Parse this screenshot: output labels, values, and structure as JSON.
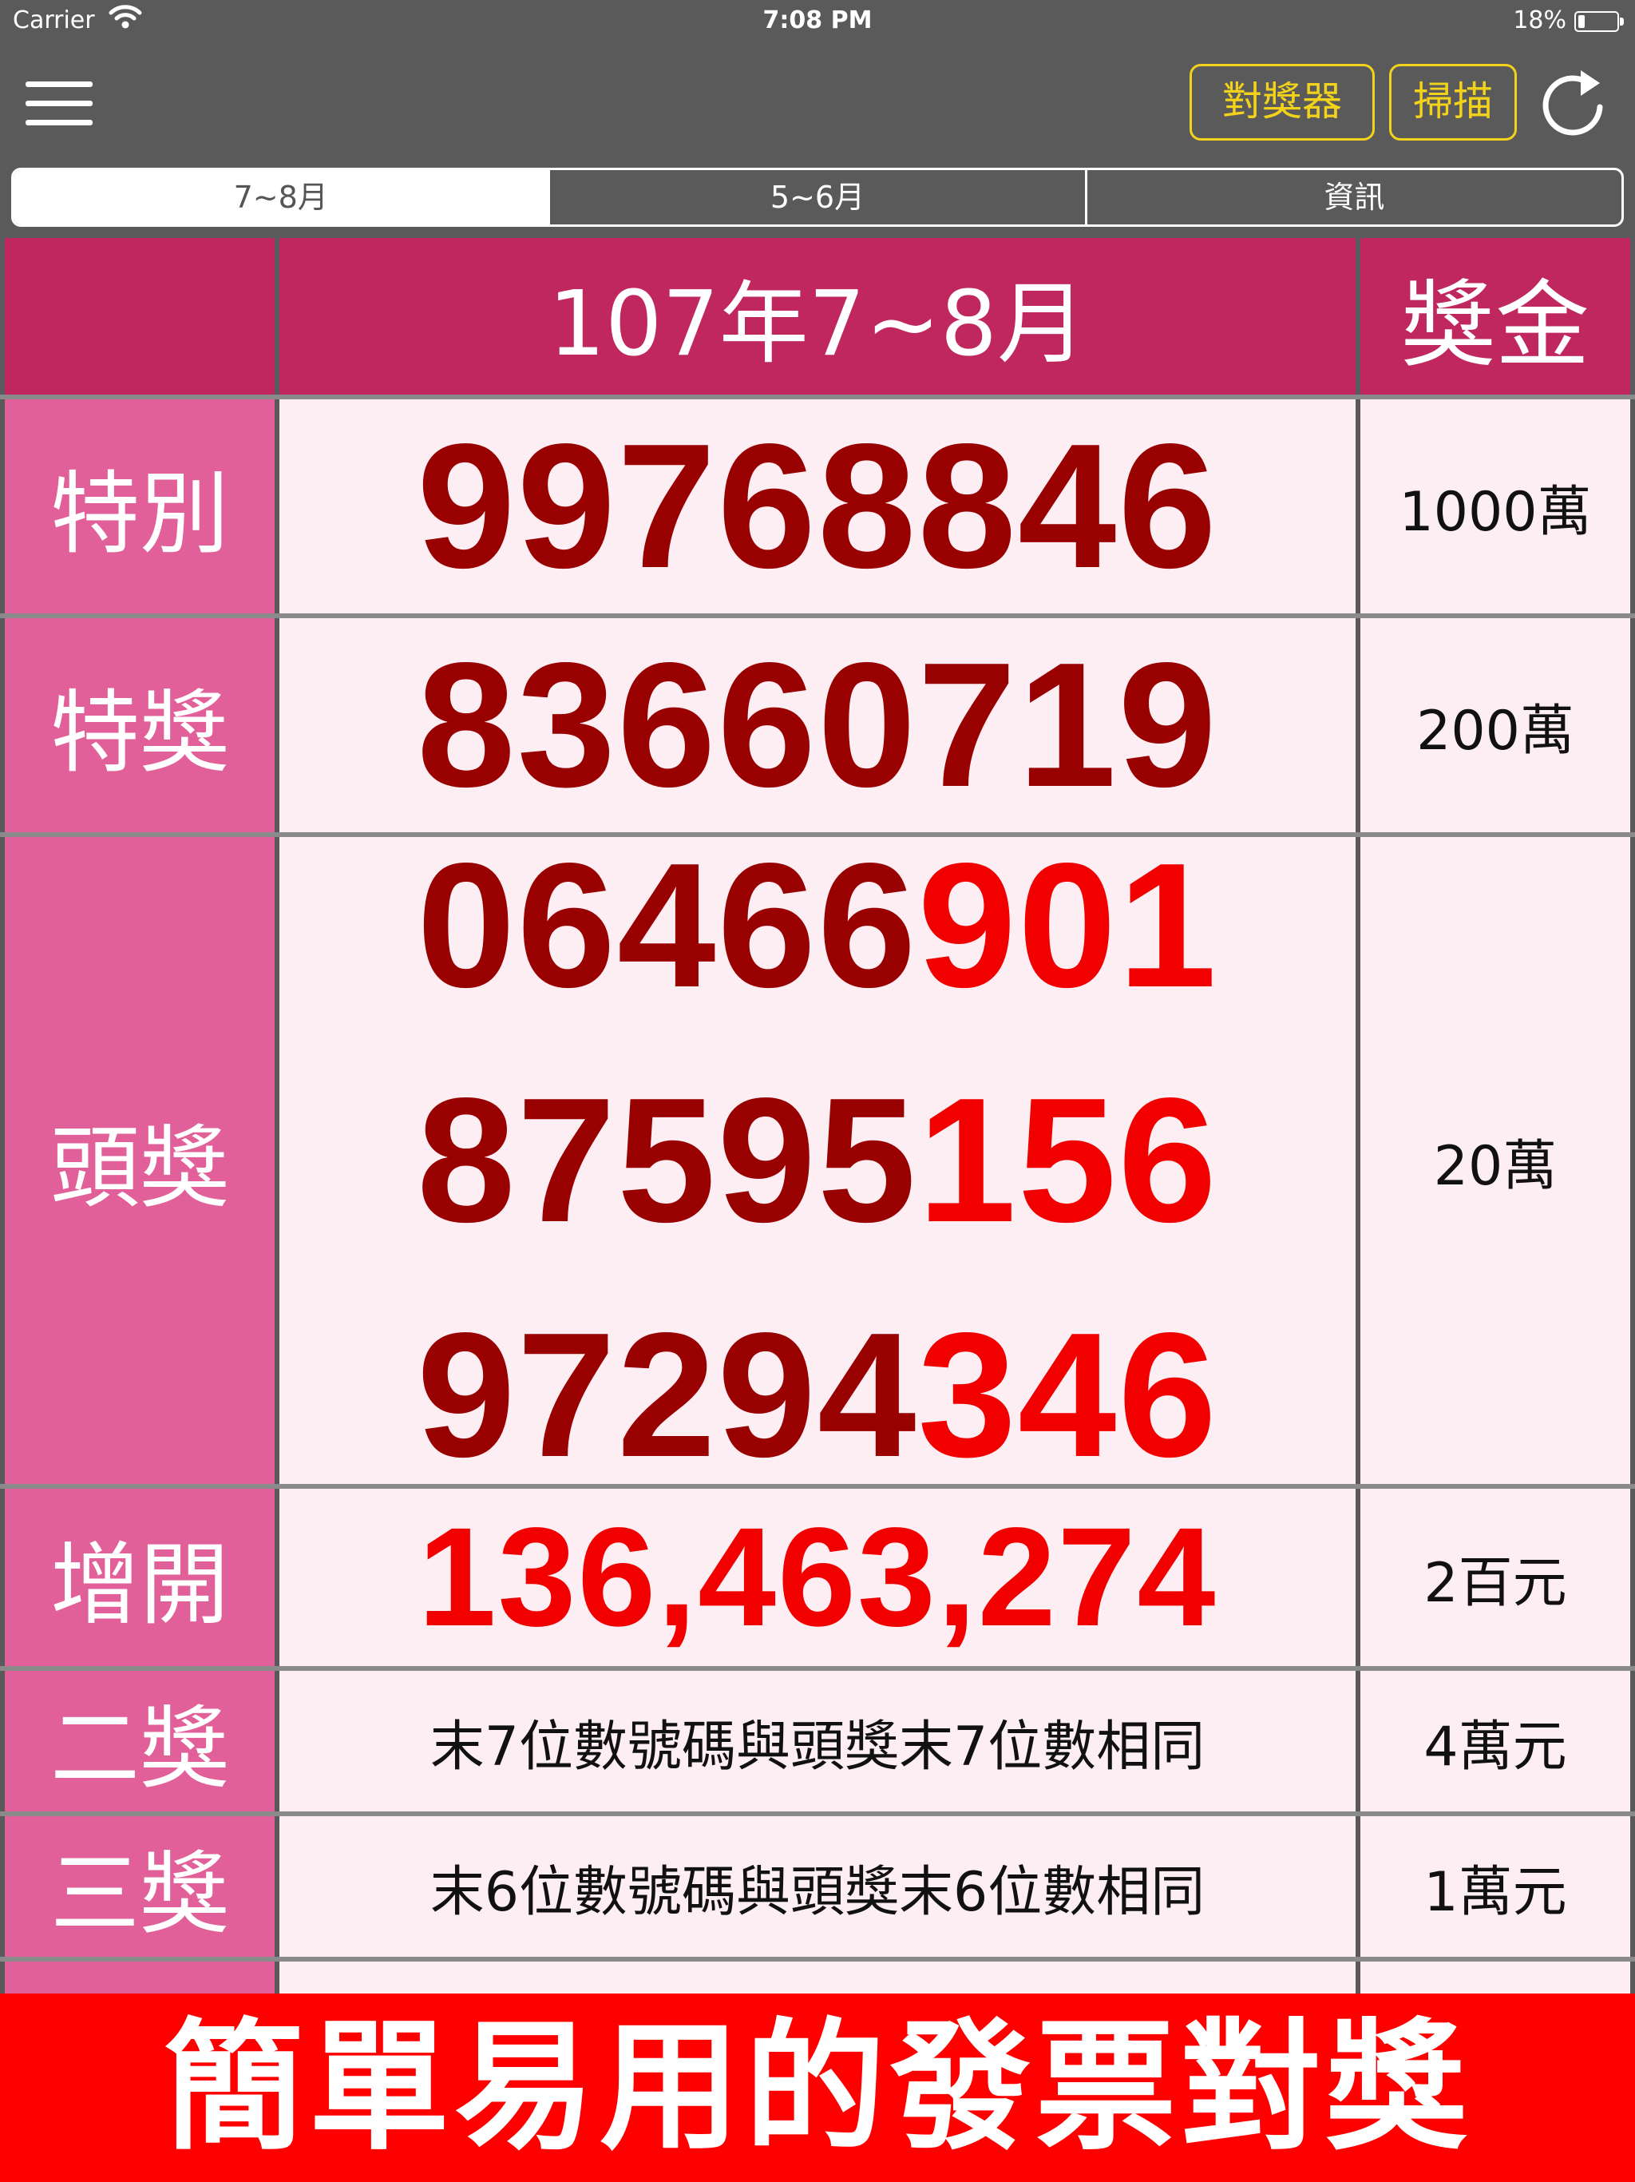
{
  "status_bar": {
    "carrier": "Carrier",
    "time": "7:08 PM",
    "battery": "18%",
    "battery_level": 0.18
  },
  "nav": {
    "menu_icon": "hamburger-menu-icon",
    "checker_label": "對獎器",
    "scan_label": "掃描",
    "refresh_icon": "refresh-icon",
    "accent_color": "#f2d21a"
  },
  "tabs": [
    {
      "label": "7~8月",
      "active": true
    },
    {
      "label": "5~6月",
      "active": false
    },
    {
      "label": "資訊",
      "active": false
    }
  ],
  "table": {
    "header": {
      "blank": "",
      "period": "107年7~8月",
      "prize_header": "獎金"
    },
    "special": {
      "label": "特別",
      "number": "99768846",
      "amount": "1000萬"
    },
    "grand": {
      "label": "特獎",
      "number": "83660719",
      "amount": "200萬"
    },
    "first": {
      "label": "頭獎",
      "numbers": [
        {
          "lead": "06466",
          "tail": "901"
        },
        {
          "lead": "87595",
          "tail": "156"
        },
        {
          "lead": "97294",
          "tail": "346"
        }
      ],
      "amount": "20萬"
    },
    "additional": {
      "label": "增開",
      "numbers": "136,463,274",
      "amount": "2百元"
    },
    "second": {
      "label": "二獎",
      "desc": "末7位數號碼與頭獎末7位數相同",
      "amount": "4萬元"
    },
    "third": {
      "label": "三獎",
      "desc": "末6位數號碼與頭獎末6位數相同",
      "amount": "1萬元"
    }
  },
  "colors": {
    "header_bg": "#c0275e",
    "label_bg": "#e2609a",
    "cell_bg": "#fdeef4",
    "number_dark": "#990000",
    "number_highlight": "#f20000"
  },
  "banner": {
    "text": "簡單易用的發票對獎"
  }
}
